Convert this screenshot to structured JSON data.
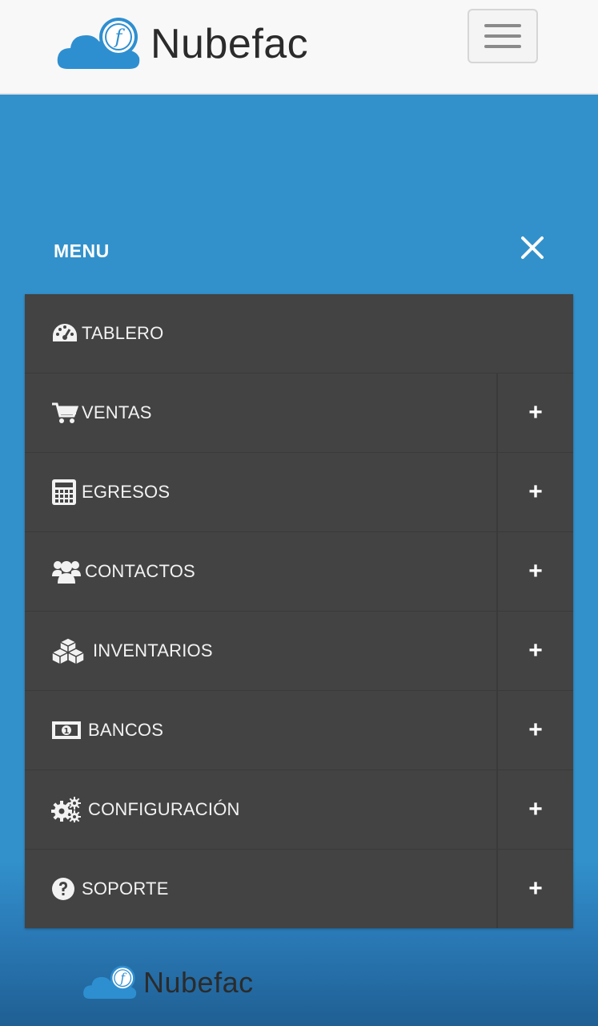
{
  "header": {
    "brand_name": "Nubefac",
    "logo_icon": "nubefac-cloud-logo-icon",
    "menu_button_icon": "hamburger-icon"
  },
  "menu": {
    "title": "MENU",
    "close_icon": "close-icon",
    "items": [
      {
        "label": "TABLERO",
        "icon": "dashboard-icon",
        "expandable": false
      },
      {
        "label": "VENTAS",
        "icon": "cart-icon",
        "expandable": true,
        "toggle": "+"
      },
      {
        "label": "EGRESOS",
        "icon": "calculator-icon",
        "expandable": true,
        "toggle": "+"
      },
      {
        "label": "CONTACTOS",
        "icon": "users-icon",
        "expandable": true,
        "toggle": "+"
      },
      {
        "label": "INVENTARIOS",
        "icon": "cubes-icon",
        "expandable": true,
        "toggle": "+"
      },
      {
        "label": "BANCOS",
        "icon": "money-icon",
        "expandable": true,
        "toggle": "+"
      },
      {
        "label": "CONFIGURACIÓN",
        "icon": "gears-icon",
        "expandable": true,
        "toggle": "+"
      },
      {
        "label": "SOPORTE",
        "icon": "question-icon",
        "expandable": true,
        "toggle": "+"
      }
    ]
  },
  "footer": {
    "brand_name": "Nubefac"
  },
  "colors": {
    "header_bg": "#f8f8f8",
    "page_bg": "#3291cb",
    "menu_bg": "#434343",
    "logo_blue": "#2e8fd0"
  }
}
